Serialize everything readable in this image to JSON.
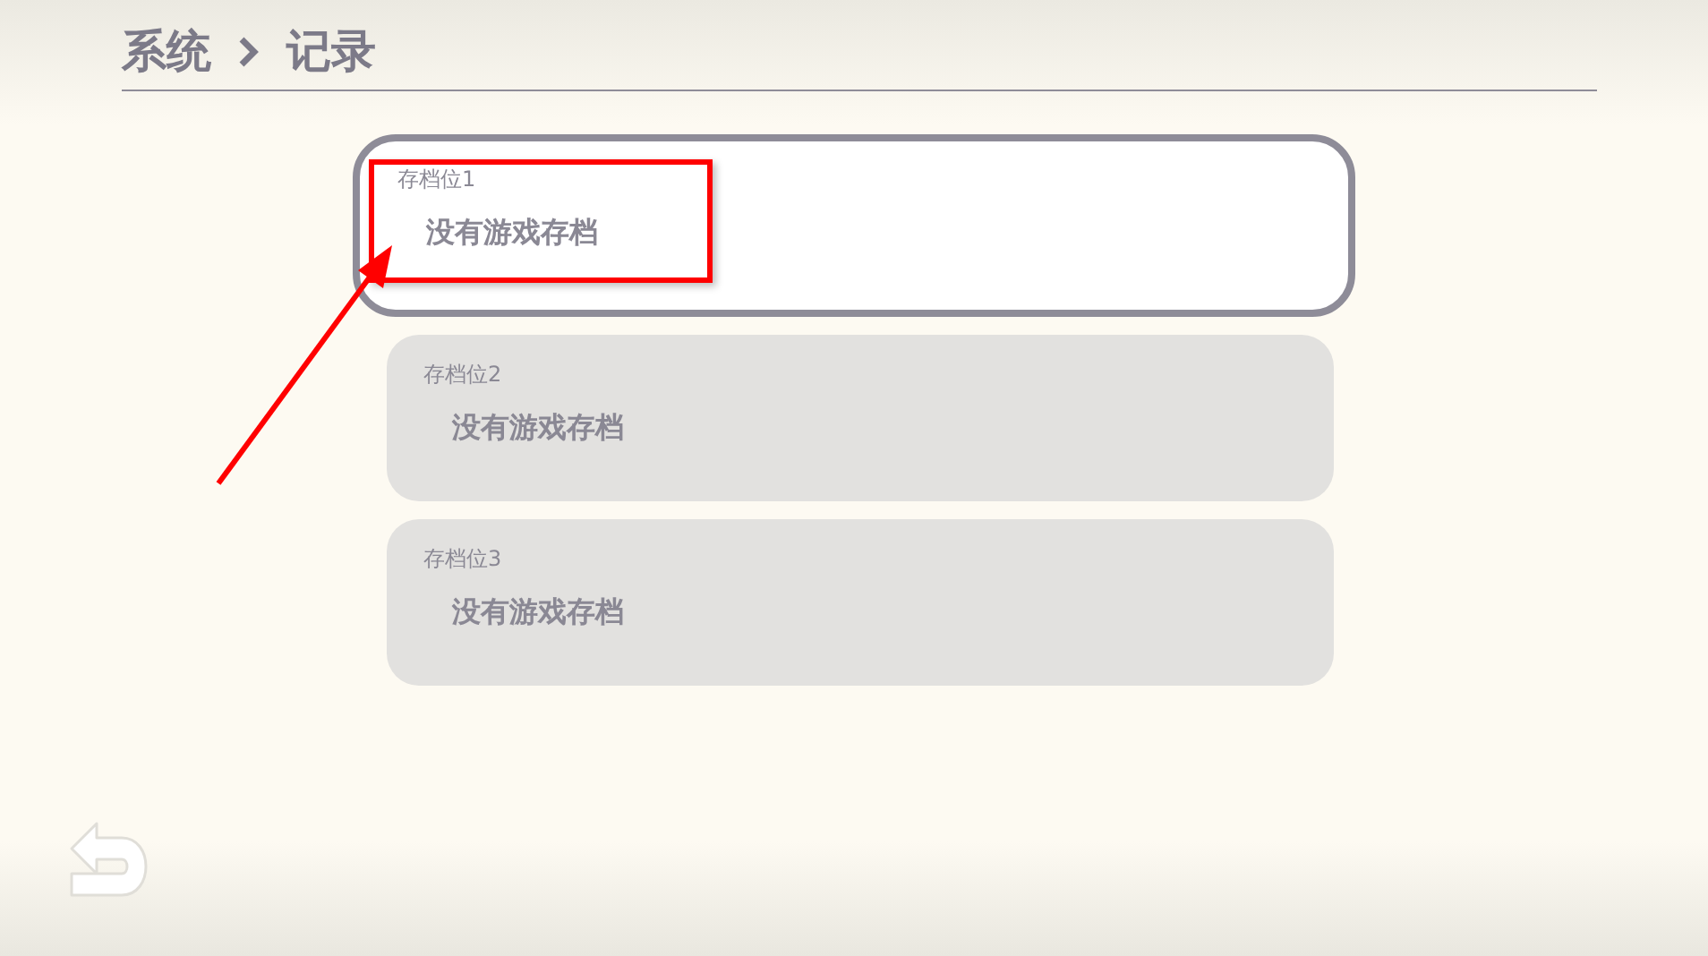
{
  "breadcrumb": [
    {
      "label": "系统"
    },
    {
      "label": "记录"
    }
  ],
  "save_slots": [
    {
      "label": "存档位1",
      "status": "没有游戏存档",
      "selected": true
    },
    {
      "label": "存档位2",
      "status": "没有游戏存档",
      "selected": false
    },
    {
      "label": "存档位3",
      "status": "没有游戏存档",
      "selected": false
    }
  ],
  "annotation": {
    "kind": "highlight-arrow"
  }
}
